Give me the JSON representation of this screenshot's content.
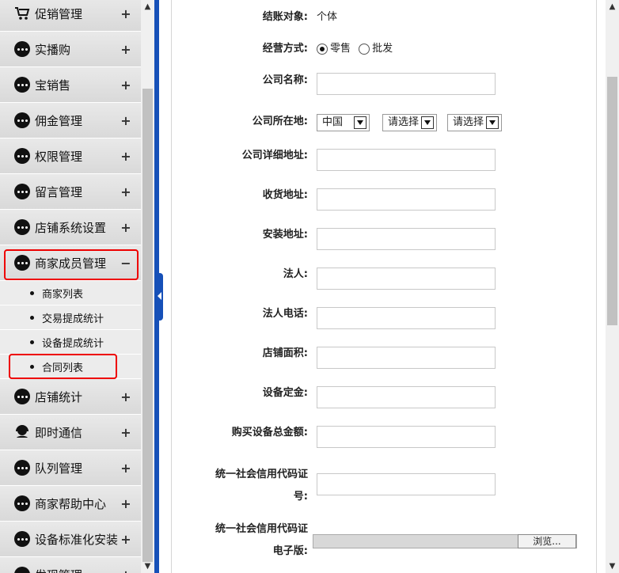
{
  "sidebar": {
    "items": [
      {
        "label": "促销管理",
        "icon": "cart-icon",
        "toggle": "+"
      },
      {
        "label": "实播购",
        "icon": "dots-icon",
        "toggle": "+"
      },
      {
        "label": "宝销售",
        "icon": "dots-icon",
        "toggle": "+"
      },
      {
        "label": "佣金管理",
        "icon": "dots-icon",
        "toggle": "+"
      },
      {
        "label": "权限管理",
        "icon": "dots-icon",
        "toggle": "+"
      },
      {
        "label": "留言管理",
        "icon": "dots-icon",
        "toggle": "+"
      },
      {
        "label": "店铺系统设置",
        "icon": "dots-icon",
        "toggle": "+"
      },
      {
        "label": "商家成员管理",
        "icon": "dots-icon",
        "toggle": "−"
      }
    ],
    "subitems": [
      "商家列表",
      "交易提成统计",
      "设备提成统计",
      "合同列表"
    ],
    "items_after": [
      {
        "label": "店铺统计",
        "icon": "dots-icon",
        "toggle": "+"
      },
      {
        "label": "即时通信",
        "icon": "headset-icon",
        "toggle": "+"
      },
      {
        "label": "队列管理",
        "icon": "dots-icon",
        "toggle": "+"
      },
      {
        "label": "商家帮助中心",
        "icon": "dots-icon",
        "toggle": "+"
      },
      {
        "label": "设备标准化安装",
        "icon": "dots-icon",
        "toggle": "+"
      },
      {
        "label": "发现管理",
        "icon": "dots-icon",
        "toggle": "+"
      }
    ]
  },
  "form": {
    "settle_label": "结账对象:",
    "settle_value": "个体",
    "business_label": "经营方式:",
    "retail": "零售",
    "wholesale": "批发",
    "company_name": "公司名称:",
    "company_location": "公司所在地:",
    "country": "中国",
    "province": "请选择",
    "city": "请选择",
    "company_address": "公司详细地址:",
    "shipping_address": "收货地址:",
    "install_address": "安装地址:",
    "legal_person": "法人:",
    "legal_phone": "法人电话:",
    "store_area": "店铺面积:",
    "device_deposit": "设备定金:",
    "device_total": "购买设备总金额:",
    "credit_code_line1": "统一社会信用代码证",
    "credit_code_line2": "号:",
    "credit_ecopy_line1": "统一社会信用代码证",
    "credit_ecopy_line2": "电子版:",
    "browse": "浏览..."
  }
}
